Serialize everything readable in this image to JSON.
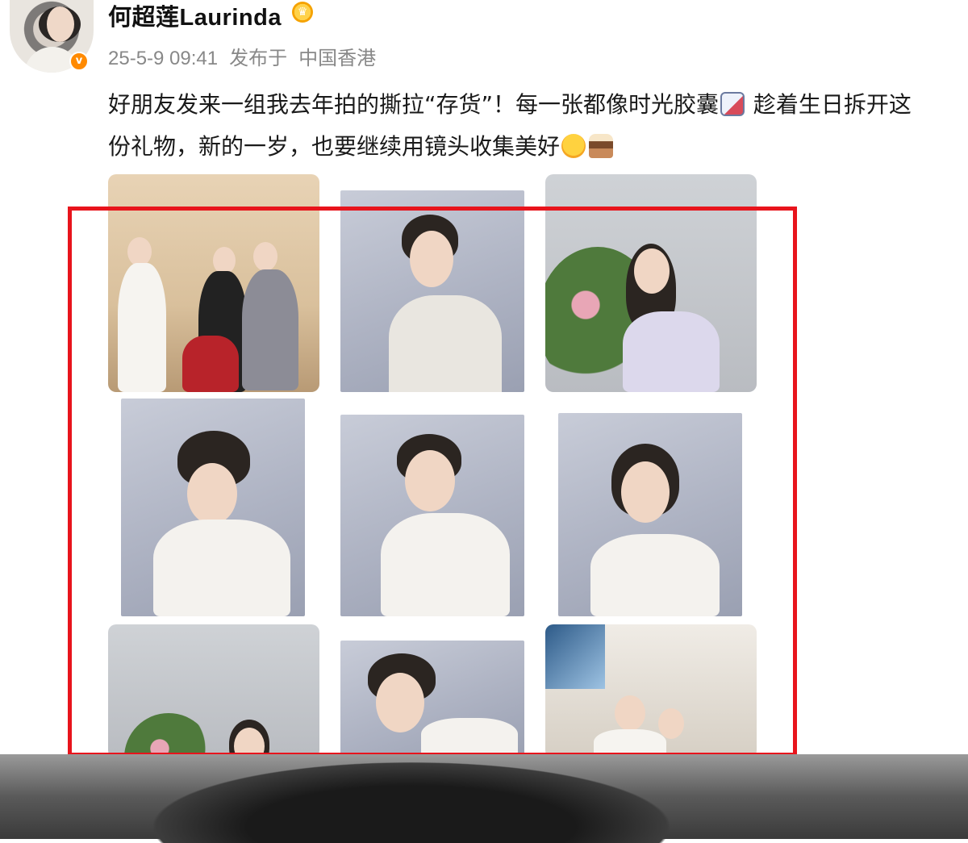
{
  "post": {
    "username": "何超莲Laurinda",
    "date": "25-5-9 09:41",
    "publish_label": "发布于",
    "location": "中国香港",
    "text_line1_a": "好朋友发来一组我去年拍的撕拉“存货”！每一张都像时光胶囊",
    "text_line1_b": " 趁着生日拆开这",
    "text_line2_a": "份礼物，新的一岁，也要继续用镜头收集美好",
    "verified_badge": "v",
    "crown_icon": "♛"
  },
  "photos": [
    {
      "name": "group-photo",
      "style": "room"
    },
    {
      "name": "studio-portrait-1",
      "style": "studio"
    },
    {
      "name": "birthday-flowers",
      "style": "flowers"
    },
    {
      "name": "studio-portrait-2",
      "style": "studio"
    },
    {
      "name": "studio-portrait-3",
      "style": "studio"
    },
    {
      "name": "studio-portrait-4",
      "style": "studio"
    },
    {
      "name": "flowers-portrait",
      "style": "flowers"
    },
    {
      "name": "studio-portrait-5",
      "style": "studio"
    },
    {
      "name": "living-room-photo",
      "style": "living"
    }
  ],
  "colors": {
    "highlight_frame": "#e8141c",
    "verified": "#ff8a00"
  }
}
